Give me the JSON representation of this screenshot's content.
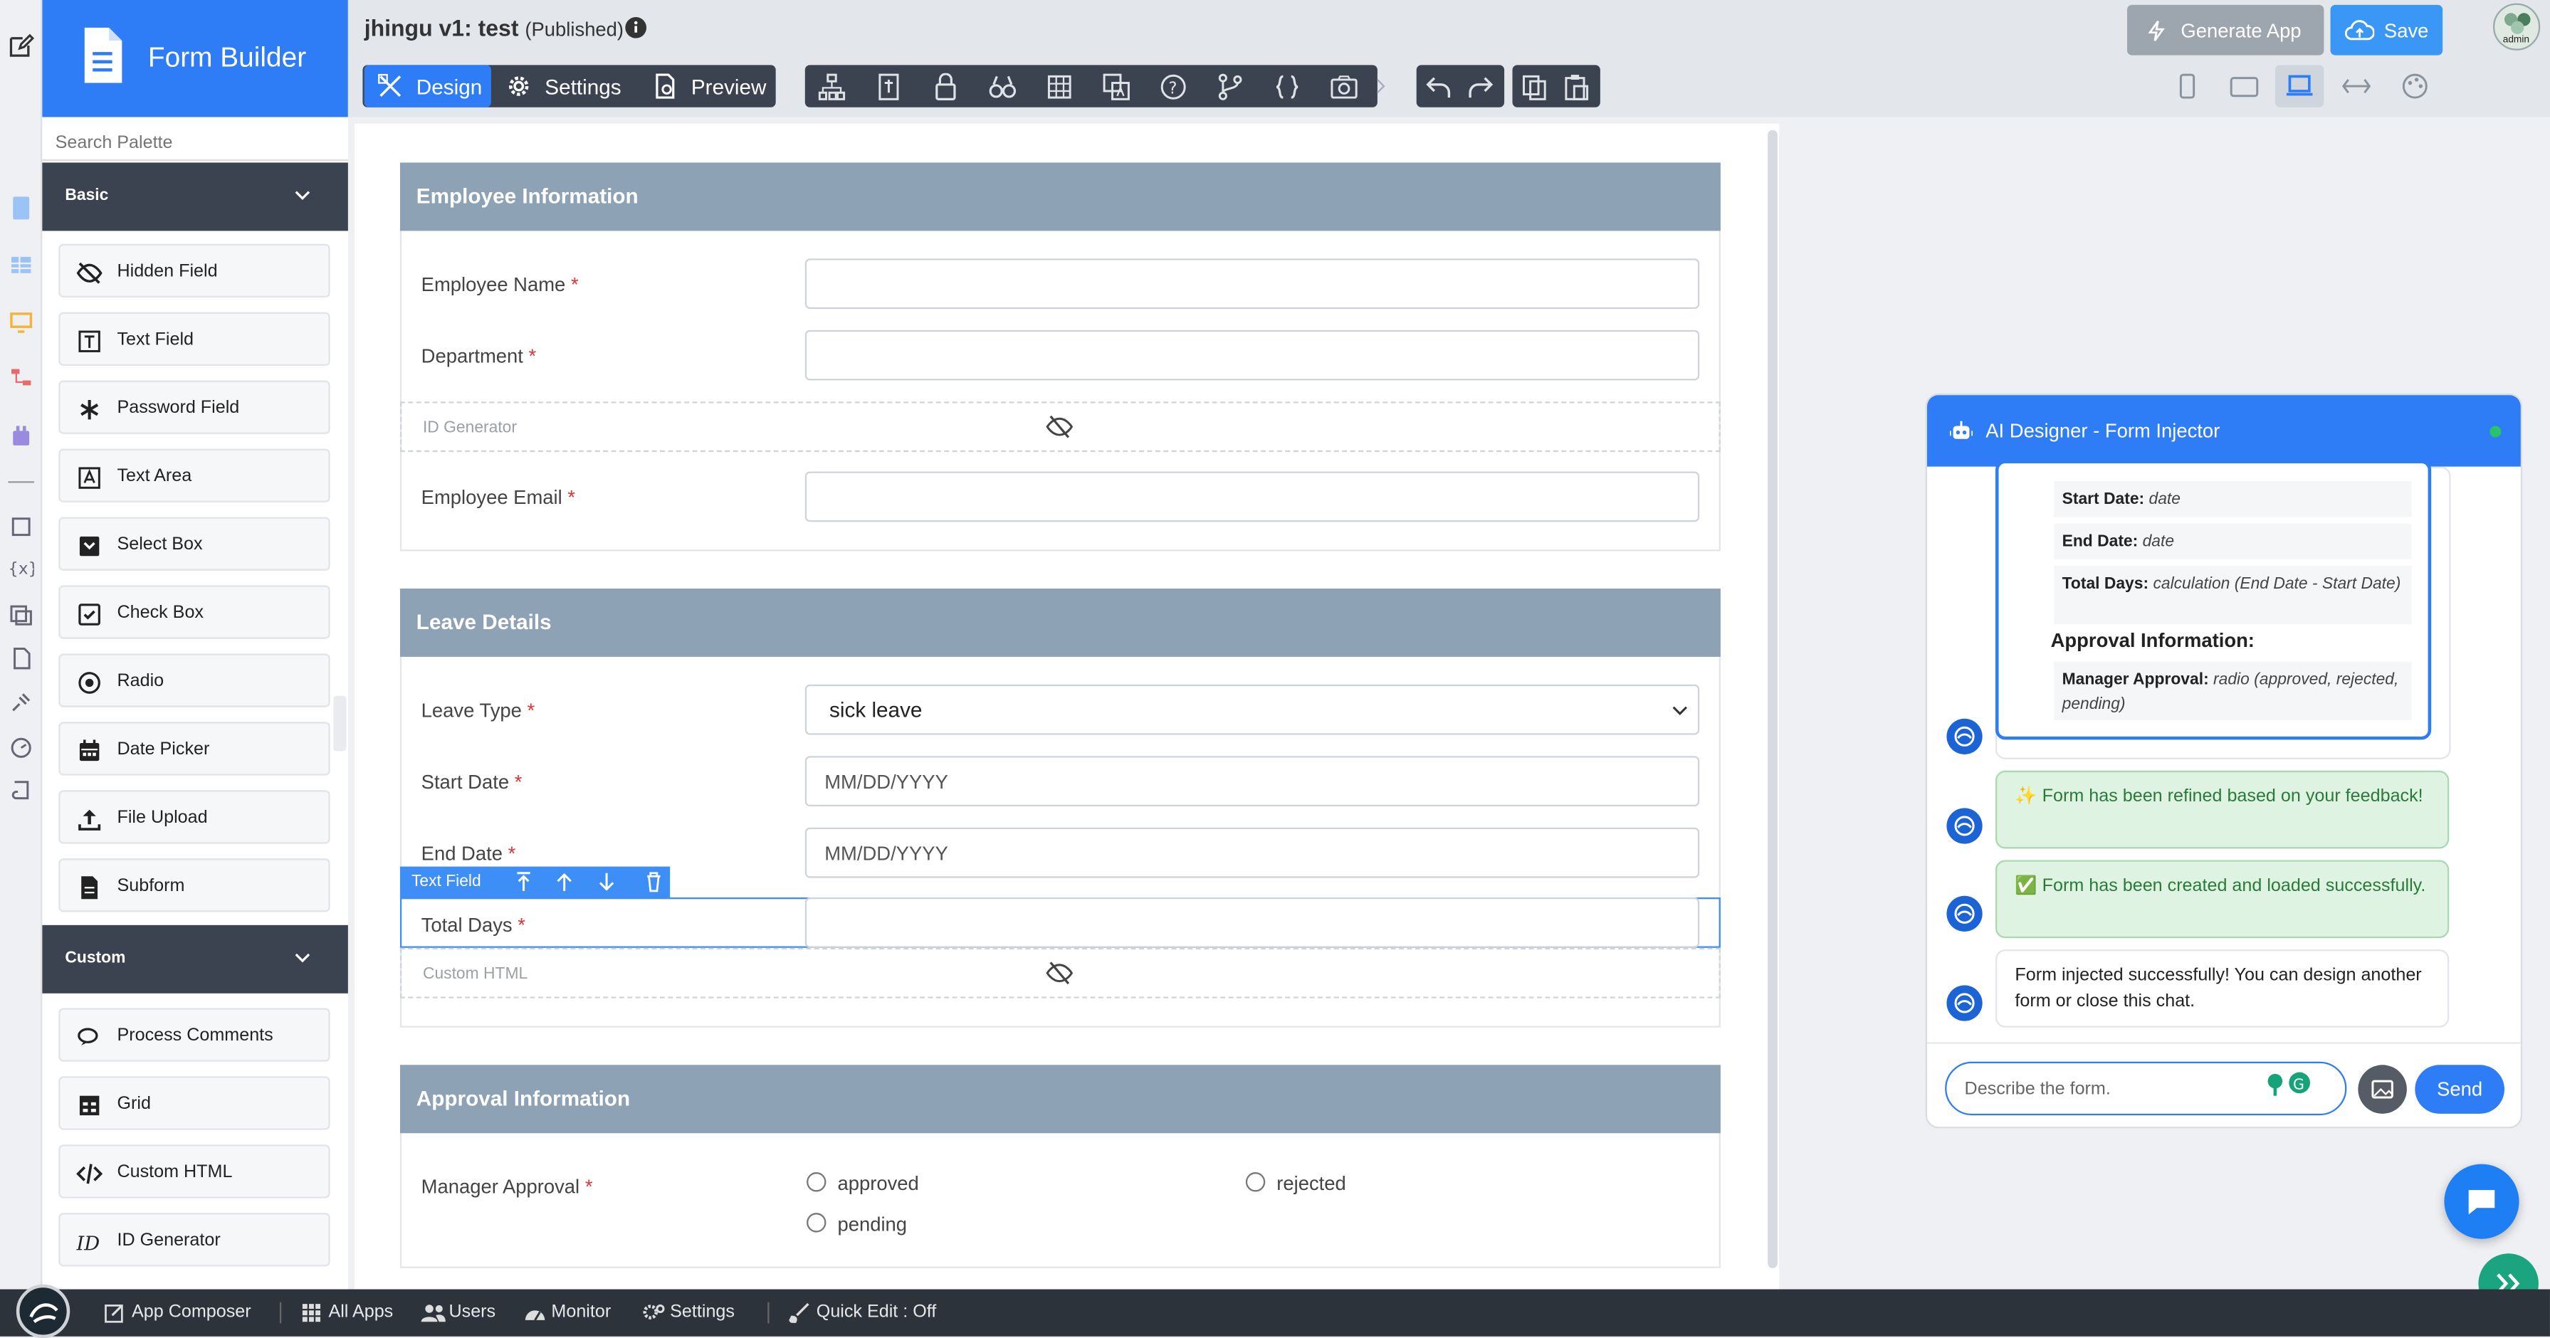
{
  "app": {
    "name": "Form Builder",
    "title": "jhingu v1: test",
    "status": "(Published)"
  },
  "palette": {
    "search_placeholder": "Search Palette",
    "basic_label": "Basic",
    "basic_items": [
      "Hidden Field",
      "Text Field",
      "Password Field",
      "Text Area",
      "Select Box",
      "Check Box",
      "Radio",
      "Date Picker",
      "File Upload",
      "Subform"
    ],
    "custom_label": "Custom",
    "custom_items": [
      "Process Comments",
      "Grid",
      "Custom HTML",
      "ID Generator"
    ]
  },
  "toolbar": {
    "design": "Design",
    "settings": "Settings",
    "preview": "Preview",
    "generate_app": "Generate App",
    "save": "Save",
    "avatar": "admin"
  },
  "form": {
    "sections": {
      "employee": "Employee Information",
      "leave": "Leave Details",
      "approval": "Approval Information"
    },
    "fields": {
      "employee_name": "Employee Name",
      "department": "Department",
      "id_generator": "ID Generator",
      "employee_email": "Employee Email",
      "leave_type": "Leave Type",
      "leave_type_value": "sick leave",
      "start_date": "Start Date",
      "start_date_placeholder": "MM/DD/YYYY",
      "end_date": "End Date",
      "end_date_placeholder": "MM/DD/YYYY",
      "total_days": "Total Days",
      "custom_html": "Custom HTML",
      "manager_approval": "Manager Approval",
      "opt_approved": "approved",
      "opt_rejected": "rejected",
      "opt_pending": "pending"
    },
    "required_mark": "*",
    "selected_toolbar_label": "Text Field"
  },
  "chat": {
    "title": "AI Designer - Form Injector",
    "summary_rows": [
      {
        "label": "Start Date:",
        "value": "date"
      },
      {
        "label": "End Date:",
        "value": "date"
      },
      {
        "label": "Total Days:",
        "value": "calculation (End Date - Start Date)"
      }
    ],
    "approval_heading": "Approval Information:",
    "approval_row": {
      "label": "Manager Approval:",
      "value": "radio (approved, rejected, pending)"
    },
    "messages": [
      "✨ Form has been refined based on your feedback!",
      "✅ Form has been created and loaded successfully.",
      "Form injected successfully! You can design another form or close this chat."
    ],
    "input_placeholder": "Describe the form.",
    "send": "Send"
  },
  "bottombar": {
    "app_composer": "App Composer",
    "all_apps": "All Apps",
    "users": "Users",
    "monitor": "Monitor",
    "settings": "Settings",
    "quick_edit": "Quick Edit : Off"
  },
  "colors": {
    "primary": "#2f7df6",
    "section_header": "#8ea2b5",
    "dark": "#3b4350",
    "success_bg": "#dff3e2"
  }
}
